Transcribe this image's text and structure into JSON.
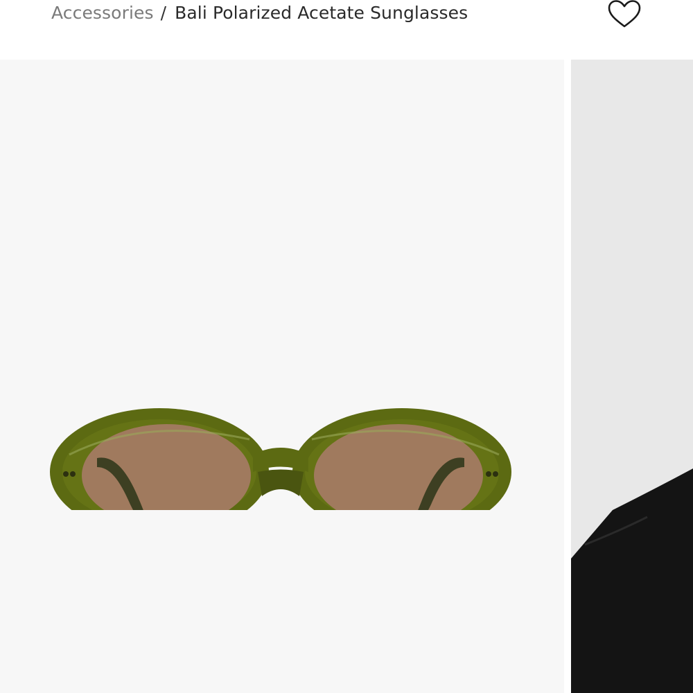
{
  "breadcrumb": {
    "parent": "Accessories",
    "separator": "/",
    "current": "Bali Polarized Acetate Sunglasses"
  },
  "icons": {
    "wishlist": "heart-outline-icon"
  },
  "gallery": {
    "main_image": "product-image-olive-oval-sunglasses",
    "next_image": "model-photo-black-jacket"
  },
  "colors": {
    "frame": "#5c6a12",
    "lens": "#a07a5e",
    "gallery_bg": "#f7f7f7",
    "model_bg": "#e8e8e8"
  }
}
